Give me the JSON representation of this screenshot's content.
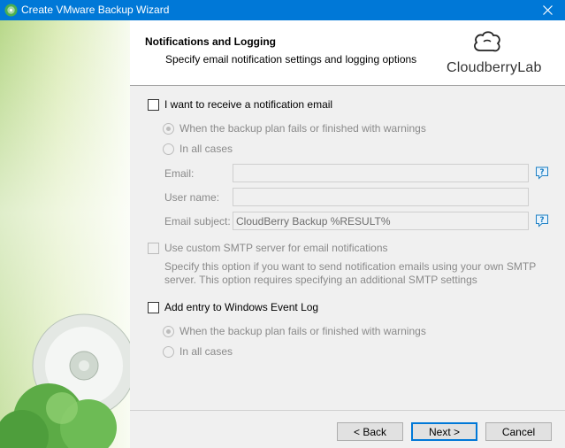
{
  "window": {
    "title": "Create VMware Backup Wizard",
    "icons": {
      "app": "cloudberry-app-icon",
      "close": "close-icon"
    }
  },
  "header": {
    "title": "Notifications and Logging",
    "subtitle": "Specify email notification settings and logging options",
    "logo_text": "CloudberryLab"
  },
  "notification": {
    "checkbox_label": "I want to receive a notification email",
    "checked": false,
    "radio_fail_label": "When the backup plan fails or finished with warnings",
    "radio_all_label": "In all cases",
    "selected_radio": "fail",
    "email_label": "Email:",
    "email_value": "",
    "username_label": "User name:",
    "username_value": "",
    "subject_label": "Email subject:",
    "subject_value": "CloudBerry Backup %RESULT%"
  },
  "smtp": {
    "checkbox_label": "Use custom SMTP server for email notifications",
    "checked": false,
    "description": "Specify this option if you want to send notification emails using your own SMTP server. This option requires specifying an additional SMTP settings"
  },
  "eventlog": {
    "checkbox_label": "Add entry to Windows Event Log",
    "checked": false,
    "radio_fail_label": "When the backup plan fails or finished with warnings",
    "radio_all_label": "In all cases",
    "selected_radio": "fail"
  },
  "footer": {
    "back_label": "< Back",
    "next_label": "Next >",
    "cancel_label": "Cancel"
  },
  "colors": {
    "titlebar": "#0078d7",
    "help_icon": "#1c7fc4",
    "disabled_text": "#8a8a8a"
  }
}
